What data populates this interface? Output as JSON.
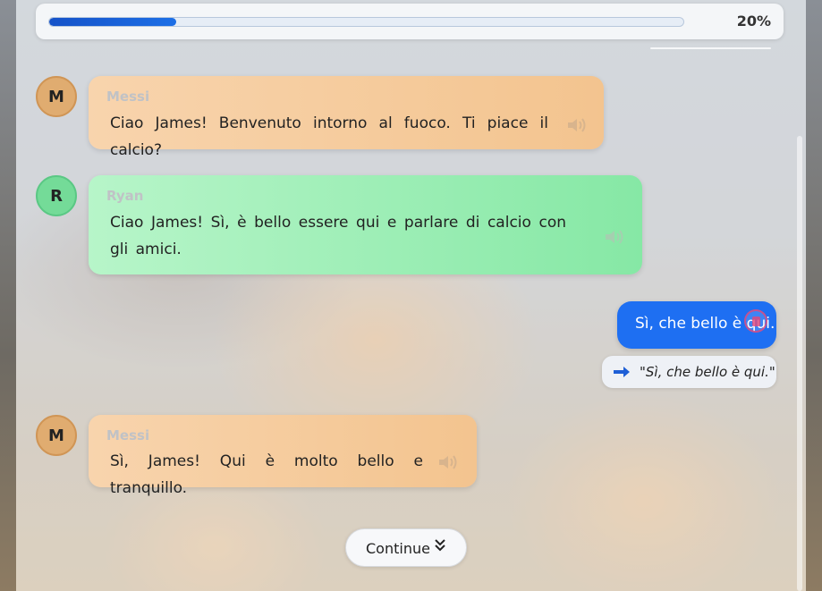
{
  "progress": {
    "percent_label": "20%",
    "fraction": 0.2
  },
  "messages": [
    {
      "avatar_initial": "M",
      "speaker": "Messi",
      "text": "Ciao James! Benvenuto intorno al fuoco. Ti piace il calcio?",
      "icon": "speaker-icon"
    },
    {
      "avatar_initial": "R",
      "speaker": "Ryan",
      "text": "Ciao James! Sì, è bello essere qui e parlare di calcio con gli amici.",
      "icon": "speaker-icon"
    },
    {
      "avatar_initial": "M",
      "speaker": "Messi",
      "text": "Sì, James! Qui è molto bello e tranquillo.",
      "icon": "speaker-icon"
    }
  ],
  "user_reply": {
    "text": "Sì, che bello è qui.",
    "icon": "record-icon"
  },
  "translation": {
    "text": "\"Sì, che bello è qui.\"",
    "icon": "arrow-right-icon"
  },
  "continue_button": {
    "label": "Continue",
    "icon": "double-chevron-down-icon"
  },
  "colors": {
    "accent_blue": "#1e6ff2",
    "messi_bubble": "#f3c48f",
    "ryan_bubble": "#86e8a5",
    "muted_speaker": "#c0c2c6"
  }
}
